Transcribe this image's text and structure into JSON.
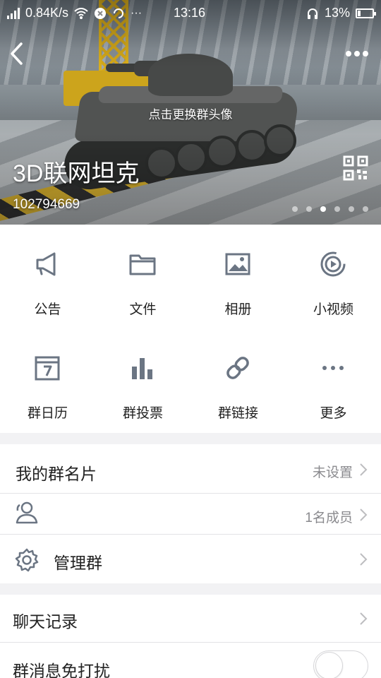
{
  "status_bar": {
    "speed": "0.84K/s",
    "time": "13:16",
    "battery": "13%"
  },
  "header": {
    "change_avatar": "点击更换群头像",
    "group_name": "3D联网坦克",
    "group_id": "102794669",
    "page_dots": 6,
    "active_dot": 2
  },
  "grid": [
    {
      "label": "公告",
      "icon": "megaphone-icon"
    },
    {
      "label": "文件",
      "icon": "folder-icon"
    },
    {
      "label": "相册",
      "icon": "album-icon"
    },
    {
      "label": "小视频",
      "icon": "short-video-icon"
    },
    {
      "label": "群日历",
      "icon": "calendar-icon",
      "day": "7"
    },
    {
      "label": "群投票",
      "icon": "bar-chart-icon"
    },
    {
      "label": "群链接",
      "icon": "link-icon"
    },
    {
      "label": "更多",
      "icon": "more-dots-icon"
    }
  ],
  "settings": {
    "my_card_label": "我的群名片",
    "my_card_value": "未设置",
    "members_value": "1名成员",
    "manage_label": "管理群",
    "chat_history_label": "聊天记录",
    "mute_label": "群消息免打扰"
  },
  "colors": {
    "icon": "#6b7583",
    "background": "#f2f2f4"
  }
}
